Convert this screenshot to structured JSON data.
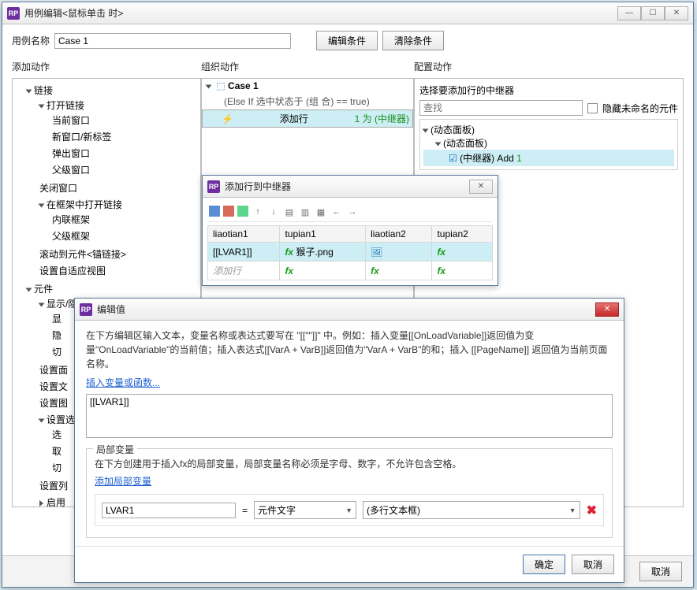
{
  "main": {
    "title": "用例编辑<鼠标单击 时>",
    "caseNameLabel": "用例名称",
    "caseName": "Case 1",
    "editCond": "编辑条件",
    "clearCond": "清除条件",
    "addActions": "添加动作",
    "orgActions": "组织动作",
    "cfgActions": "配置动作",
    "cancel": "取消"
  },
  "tree": {
    "n0": "链接",
    "n01": "打开链接",
    "n011": "当前窗口",
    "n012": "新窗口/新标签",
    "n013": "弹出窗口",
    "n014": "父级窗口",
    "n02": "关闭窗口",
    "n03": "在框架中打开链接",
    "n031": "内联框架",
    "n032": "父级框架",
    "n04": "滚动到元件<锚链接>",
    "n05": "设置自适应视图",
    "n1": "元件",
    "n11": "显示/隐",
    "n111": "显",
    "n112": "隐",
    "n113": "切",
    "n12": "设置面",
    "n13": "设置文",
    "n14": "设置图",
    "n15": "设置选",
    "n151": "选",
    "n152": "取",
    "n153": "切",
    "n16": "设置列",
    "n17": "启用"
  },
  "org": {
    "caseLabel": "Case 1",
    "cond": "(Else If 选中状态于 (组 合) == true)",
    "action": "添加行",
    "actionSuffix": "1 为 (中继器)"
  },
  "cfg": {
    "title": "选择要添加行的中继器",
    "searchPH": "查找",
    "hideUnnamed": "隐藏未命名的元件",
    "t0": "(动态面板)",
    "t1": "(动态面板)",
    "t2": "(中继器) Add",
    "t2n": "1"
  },
  "dlg1": {
    "title": "添加行到中继器",
    "h1": "liaotian1",
    "h2": "tupian1",
    "h3": "liaotian2",
    "h4": "tupian2",
    "r1c1": "[[LVAR1]]",
    "r1c2": "猴子.png",
    "r2c1": "添加行"
  },
  "dlg2": {
    "title": "编辑值",
    "help1": "在下方编辑区输入文本，变量名称或表达式要写在 \"[[\"\"]]\" 中。例如：插入变量[[OnLoadVariable]]返回值为变量\"OnLoadVariable\"的当前值；插入表达式[[VarA + VarB]]返回值为\"VarA + VarB\"的和；插入 [[PageName]] 返回值为当前页面名称。",
    "insertVar": "插入变量或函数...",
    "text": "[[LVAR1]]",
    "localVarTitle": "局部变量",
    "localVarHelp": "在下方创建用于插入fx的局部变量，局部变量名称必须是字母、数字，不允许包含空格。",
    "addLocal": "添加局部变量",
    "lv_name": "LVAR1",
    "eq": "=",
    "lv_type": "元件文字",
    "lv_target": "(多行文本框)",
    "ok": "确定",
    "cancel": "取消"
  }
}
